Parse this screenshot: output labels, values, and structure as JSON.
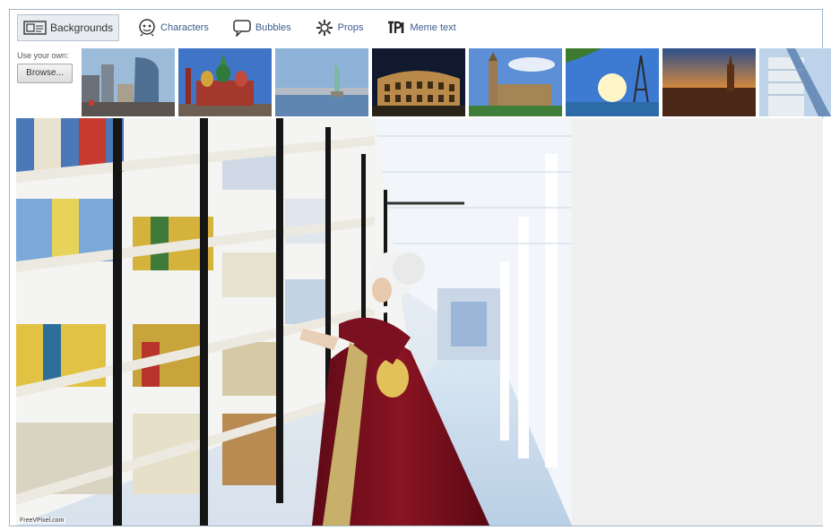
{
  "toolbar": {
    "tabs": [
      {
        "label": "Backgrounds",
        "icon": "backgrounds-icon",
        "active": true
      },
      {
        "label": "Characters",
        "icon": "character-face-icon",
        "active": false
      },
      {
        "label": "Bubbles",
        "icon": "speech-bubble-icon",
        "active": false
      },
      {
        "label": "Props",
        "icon": "props-gear-icon",
        "active": false
      },
      {
        "label": "Meme text",
        "icon": "meme-text-icon",
        "active": false
      }
    ]
  },
  "upload": {
    "label": "Use your own:",
    "button": "Browse..."
  },
  "thumbnails": [
    {
      "name": "city-skyline"
    },
    {
      "name": "st-basils-cathedral"
    },
    {
      "name": "statue-of-liberty"
    },
    {
      "name": "colosseum-night"
    },
    {
      "name": "big-ben"
    },
    {
      "name": "eiffel-tower"
    },
    {
      "name": "city-sunset"
    },
    {
      "name": "modern-building"
    }
  ],
  "canvas": {
    "credit": "FreeVPixel.com"
  },
  "colors": {
    "tab_text": "#3b5c8f",
    "frame_border": "#9fb6cc",
    "dress": "#7a1020"
  }
}
